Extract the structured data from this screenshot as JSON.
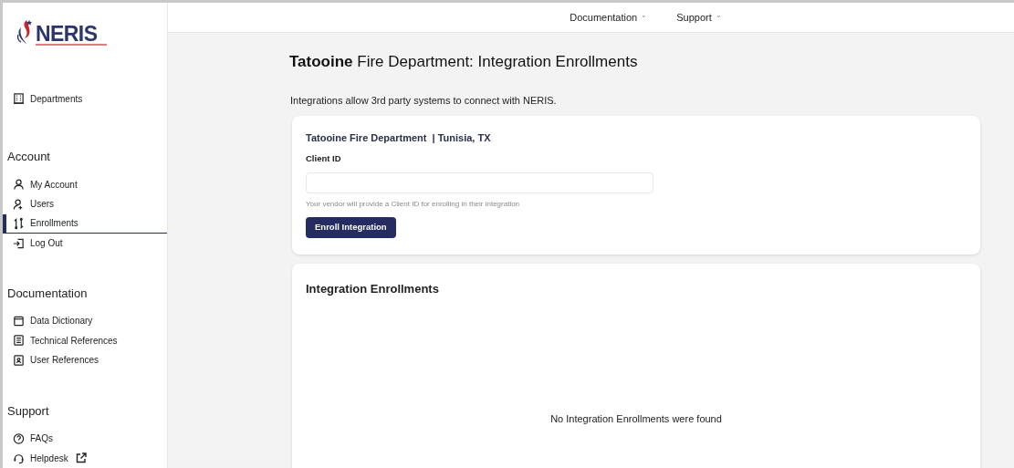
{
  "logo": {
    "name": "NERIS"
  },
  "top_nav": [
    {
      "label": "Documentation",
      "caret": "⌄"
    },
    {
      "label": "Support",
      "caret": "⌄"
    }
  ],
  "sidebar": {
    "sections": [
      {
        "items": [
          {
            "label": "Departments",
            "selected": false,
            "external": false
          }
        ]
      },
      {
        "heading": "Account",
        "items": [
          {
            "label": "My Account",
            "selected": false,
            "external": false
          },
          {
            "label": "Users",
            "selected": false,
            "external": false
          },
          {
            "label": "Enrollments",
            "selected": true,
            "external": false
          },
          {
            "label": "Log Out",
            "selected": false,
            "external": false
          }
        ]
      },
      {
        "heading": "Documentation",
        "items": [
          {
            "label": "Data Dictionary",
            "selected": false,
            "external": false
          },
          {
            "label": "Technical References",
            "selected": false,
            "external": false
          },
          {
            "label": "User References",
            "selected": false,
            "external": false
          }
        ]
      },
      {
        "heading": "Support",
        "items": [
          {
            "label": "FAQs",
            "selected": false,
            "external": false
          },
          {
            "label": "Helpdesk",
            "selected": false,
            "external": true
          }
        ]
      }
    ]
  },
  "page": {
    "title": "**Tatooine** Fire Department: Integration Enrollments",
    "intro": "Integrations allow 3rd party systems to connect with NERIS."
  },
  "enroll_card": {
    "department": "Tatooine Fire Department  | Tunisia, TX",
    "field_label": "Client ID",
    "hint": "Your vendor will provide a Client ID for enrolling in their integration",
    "button": "Enroll Integration"
  },
  "enrollments_card": {
    "title": "Integration Enrollments",
    "empty_message": "No Integration Enrollments were found"
  }
}
